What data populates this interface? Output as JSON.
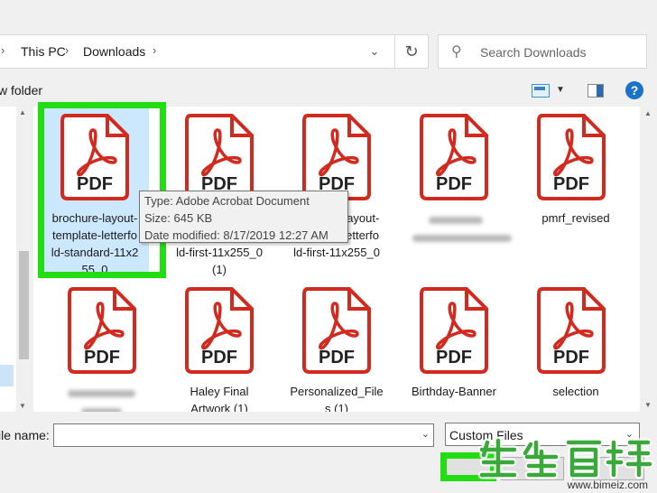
{
  "address_bar": {
    "crumbs": [
      "This PC",
      "Downloads"
    ],
    "separator": "›"
  },
  "search": {
    "placeholder": "Search Downloads"
  },
  "toolbar": {
    "new_folder_label": "w folder",
    "help_label": "?"
  },
  "files": [
    {
      "lines": [
        "brochure-layout-",
        "template-letterfo",
        "ld-standard-11x2",
        "55_0"
      ],
      "selected": true
    },
    {
      "lines": [
        "",
        "",
        "ld-first-11x255_0",
        "(1)"
      ],
      "selected": false
    },
    {
      "lines": [
        "brochure-layout-",
        "template-letterfo",
        "ld-first-11x255_0"
      ],
      "selected": false
    },
    {
      "lines": [],
      "blurred": true
    },
    {
      "lines": [
        "pmrf_revised"
      ],
      "selected": false
    },
    {
      "lines": [],
      "blurred": true
    },
    {
      "lines": [
        "Haley Final",
        "Artwork (1)"
      ],
      "selected": false
    },
    {
      "lines": [
        "Personalized_File",
        "s (1)"
      ],
      "selected": false
    },
    {
      "lines": [
        "Birthday-Banner"
      ],
      "selected": false
    },
    {
      "lines": [
        "selection"
      ],
      "selected": false
    }
  ],
  "icon_text": "PDF",
  "tooltip": {
    "type_line": "Type: Adobe Acrobat Document",
    "size_line": "Size: 645 KB",
    "date_line": "Date modified: 8/17/2019 12:27 AM"
  },
  "bottom": {
    "file_name_label": "ile name:",
    "file_name_value": "",
    "file_type_value": "Custom Files"
  },
  "watermark": {
    "text": "www.bimeiz.com"
  },
  "colors": {
    "highlight": "#22dd11",
    "pdf_red": "#d22a1e",
    "selection": "#cce8ff"
  }
}
